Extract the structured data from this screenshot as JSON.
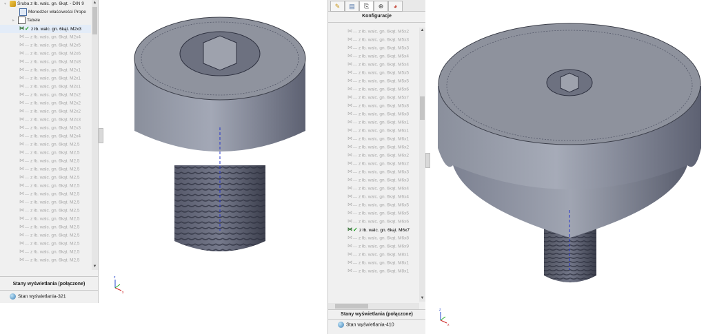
{
  "left": {
    "root_label": "Śruba z łb. walc. gn. 6kąt. - DIN 9",
    "nodes": [
      {
        "label": "Menedżer właściwości Prope"
      },
      {
        "label": "Tabele"
      }
    ],
    "active_config": "z łb. walc. gn. 6kąt. M2x3",
    "configs": [
      "z łb. walc. gn. 6kąt. M2x4",
      "z łb. walc. gn. 6kąt. M2x5",
      "z łb. walc. gn. 6kąt. M2x6",
      "z łb. walc. gn. 6kąt. M2x8",
      "z łb. walc. gn. 6kąt. M2x1",
      "z łb. walc. gn. 6kąt. M2x1",
      "z łb. walc. gn. 6kąt. M2x1",
      "z łb. walc. gn. 6kąt. M2x2",
      "z łb. walc. gn. 6kąt. M2x2",
      "z łb. walc. gn. 6kąt. M2x2",
      "z łb. walc. gn. 6kąt. M2x3",
      "z łb. walc. gn. 6kąt. M2x3",
      "z łb. walc. gn. 6kąt. M2x4",
      "z łb. walc. gn. 6kąt. M2,5",
      "z łb. walc. gn. 6kąt. M2,5",
      "z łb. walc. gn. 6kąt. M2,5",
      "z łb. walc. gn. 6kąt. M2,5",
      "z łb. walc. gn. 6kąt. M2,5",
      "z łb. walc. gn. 6kąt. M2,5",
      "z łb. walc. gn. 6kąt. M2,5",
      "z łb. walc. gn. 6kąt. M2,5",
      "z łb. walc. gn. 6kąt. M2,5",
      "z łb. walc. gn. 6kąt. M2,5",
      "z łb. walc. gn. 6kąt. M2,5",
      "z łb. walc. gn. 6kąt. M2,5",
      "z łb. walc. gn. 6kąt. M2,5",
      "z łb. walc. gn. 6kąt. M2,5",
      "z łb. walc. gn. 6kąt. M2,5"
    ],
    "display_states_title": "Stany wyświetlania (połączone)",
    "display_state": "Stan wyświetlania-321"
  },
  "right": {
    "tabs": [
      "feature-manager-tab",
      "property-manager-tab",
      "configuration-manager-tab",
      "dimxpert-tab",
      "display-manager-tab"
    ],
    "section_title": "Konfiguracje",
    "configs_before": [
      "z łb. walc. gn. 6kąt. M5x2",
      "z łb. walc. gn. 6kąt. M5x3",
      "z łb. walc. gn. 6kąt. M5x3",
      "z łb. walc. gn. 6kąt. M5x4",
      "z łb. walc. gn. 6kąt. M5x4",
      "z łb. walc. gn. 6kąt. M5x5",
      "z łb. walc. gn. 6kąt. M5x5",
      "z łb. walc. gn. 6kąt. M5x6",
      "z łb. walc. gn. 6kąt. M5x7",
      "z łb. walc. gn. 6kąt. M5x8",
      "z łb. walc. gn. 6kąt. M6x8",
      "z łb. walc. gn. 6kąt. M6x1",
      "z łb. walc. gn. 6kąt. M6x1",
      "z łb. walc. gn. 6kąt. M6x1",
      "z łb. walc. gn. 6kąt. M6x2",
      "z łb. walc. gn. 6kąt. M6x2",
      "z łb. walc. gn. 6kąt. M6x2",
      "z łb. walc. gn. 6kąt. M6x3",
      "z łb. walc. gn. 6kąt. M6x3",
      "z łb. walc. gn. 6kąt. M6x4",
      "z łb. walc. gn. 6kąt. M6x4",
      "z łb. walc. gn. 6kąt. M6x5",
      "z łb. walc. gn. 6kąt. M6x5",
      "z łb. walc. gn. 6kąt. M6x6"
    ],
    "active_config": "z łb. walc. gn. 6kąt. M6x7",
    "configs_after": [
      "z łb. walc. gn. 6kąt. M6x8",
      "z łb. walc. gn. 6kąt. M6x9",
      "z łb. walc. gn. 6kąt. M8x1",
      "z łb. walc. gn. 6kąt. M8x1",
      "z łb. walc. gn. 6kąt. M8x1"
    ],
    "display_states_title": "Stany wyświetlania (połączone)",
    "display_state": "Stan wyświetlania-410"
  },
  "colors": {
    "panel_bg": "#f0f0f0",
    "check": "#16a01b",
    "axis": "#2233cc"
  }
}
